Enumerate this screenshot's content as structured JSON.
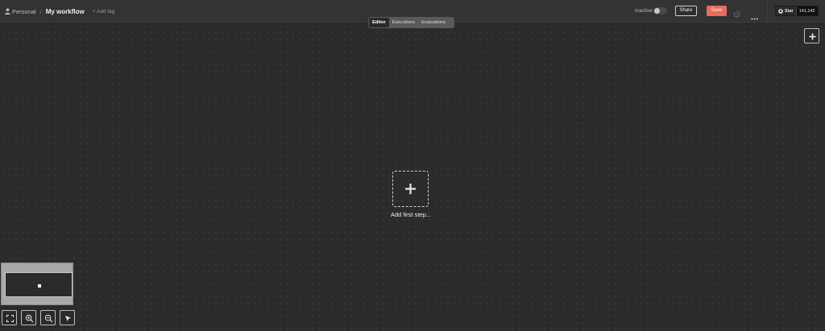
{
  "header": {
    "project": "Personal",
    "workflow_name": "My workflow",
    "add_tag": "+ Add tag",
    "status_label": "Inactive",
    "share_label": "Share",
    "save_label": "Save",
    "github": {
      "star_label": "Star",
      "star_count": "141,142"
    }
  },
  "tabs": [
    {
      "label": "Editor",
      "active": true
    },
    {
      "label": "Executions",
      "active": false
    },
    {
      "label": "Evaluations",
      "active": false
    }
  ],
  "canvas": {
    "add_first_step_label": "Add first step..."
  },
  "colors": {
    "canvas_bg": "#2b2b2b",
    "header_bg": "#333333",
    "save_button": "#e86b5f",
    "text_primary": "#f0f0f0"
  },
  "icons": {
    "person": "person-icon",
    "github": "github-icon",
    "history": "history-icon",
    "more": "more-icon",
    "plus": "plus-icon",
    "fit_view": "fit-view-icon",
    "zoom_in": "zoom-in-icon",
    "zoom_out": "zoom-out-icon",
    "cursor": "cursor-icon"
  }
}
